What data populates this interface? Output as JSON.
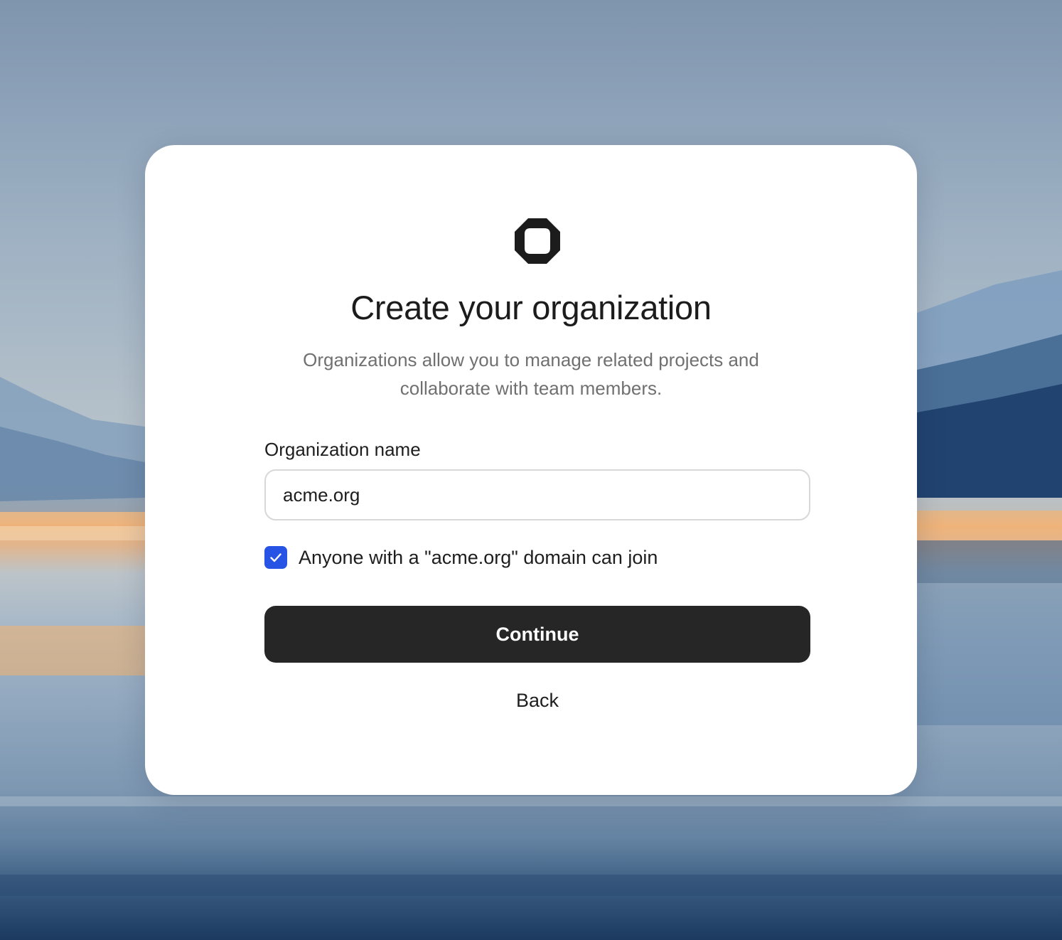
{
  "page": {
    "title": "Create your organization",
    "subtitle": "Organizations allow you to manage related projects and collaborate with team members."
  },
  "logo": {
    "icon": "octagon-logo-icon"
  },
  "form": {
    "org_name_label": "Organization name",
    "org_name_value": "acme.org",
    "domain_join_checked": true,
    "domain_join_label": "Anyone with a \"acme.org\" domain can join",
    "continue_label": "Continue",
    "back_label": "Back"
  },
  "colors": {
    "primary_button": "#262626",
    "checkbox_accent": "#2754e4"
  }
}
